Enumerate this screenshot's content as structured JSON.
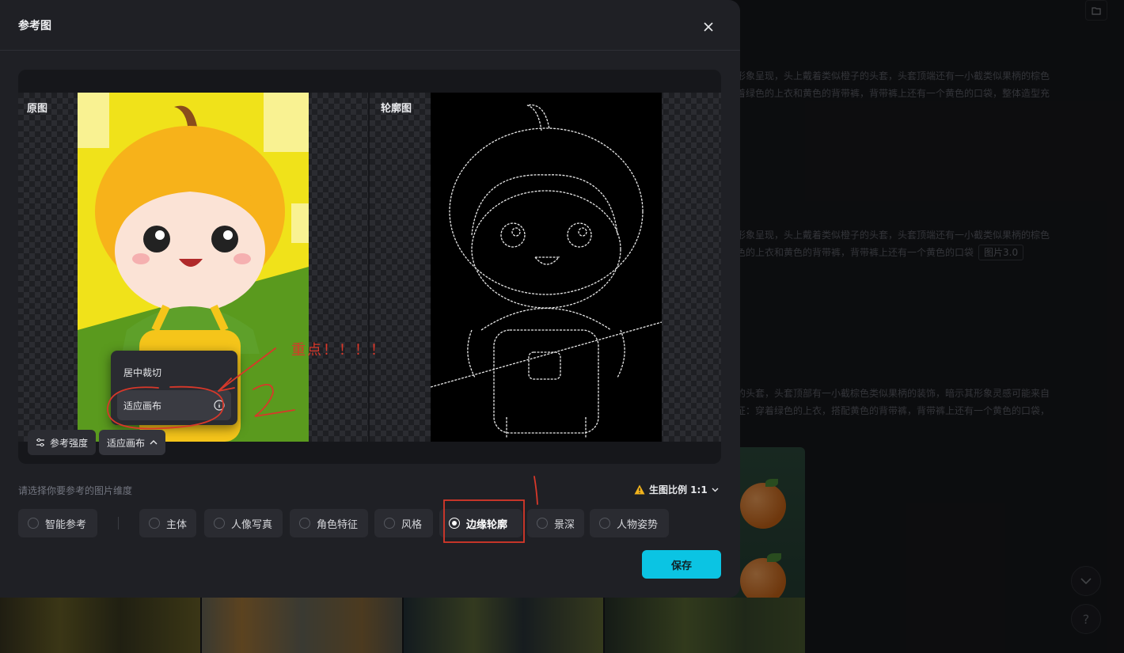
{
  "background": {
    "text_blocks": [
      {
        "lines": [
          "形象呈现，头上戴着类似橙子的头套，头套顶端还有一小截类似果柄的棕色",
          "着绿色的上衣和黄色的背带裤，背带裤上还有一个黄色的口袋，整体造型充"
        ],
        "tag": ""
      },
      {
        "lines": [
          "形象呈现，头上戴着类似橙子的头套，头套顶端还有一小截类似果柄的棕色",
          "色的上衣和黄色的背带裤，背带裤上还有一个黄色的口袋"
        ],
        "tag": "图片3.0"
      },
      {
        "lines": [
          "的头套，头套顶部有一小截棕色类似果柄的装饰，暗示其形象灵感可能来自",
          "征：穿着绿色的上衣，搭配黄色的背带裤，背带裤上还有一个黄色的口袋，"
        ],
        "tag": ""
      }
    ],
    "help_label": "?"
  },
  "modal": {
    "title": "参考图",
    "preview": {
      "original_label": "原图",
      "edge_label": "轮廓图"
    },
    "crop_menu": {
      "items": [
        "居中裁切",
        "适应画布"
      ],
      "selected": "适应画布"
    },
    "controls": {
      "strength_label": "参考强度",
      "fit_label": "适应画布"
    },
    "hint": "请选择你要参考的图片维度",
    "ratio_label": "生图比例 1:1",
    "dimensions": [
      {
        "label": "智能参考",
        "selected": false
      },
      {
        "label": "主体",
        "selected": false
      },
      {
        "label": "人像写真",
        "selected": false
      },
      {
        "label": "角色特征",
        "selected": false
      },
      {
        "label": "风格",
        "selected": false
      },
      {
        "label": "边缘轮廓",
        "selected": true
      },
      {
        "label": "景深",
        "selected": false
      },
      {
        "label": "人物姿势",
        "selected": false
      }
    ],
    "save_label": "保存"
  },
  "annotations": {
    "emphasis_text": "重点！！！！"
  },
  "colors": {
    "accent": "#0bc4e3",
    "annotation": "#d8382a",
    "modal_bg": "#1f2025"
  }
}
